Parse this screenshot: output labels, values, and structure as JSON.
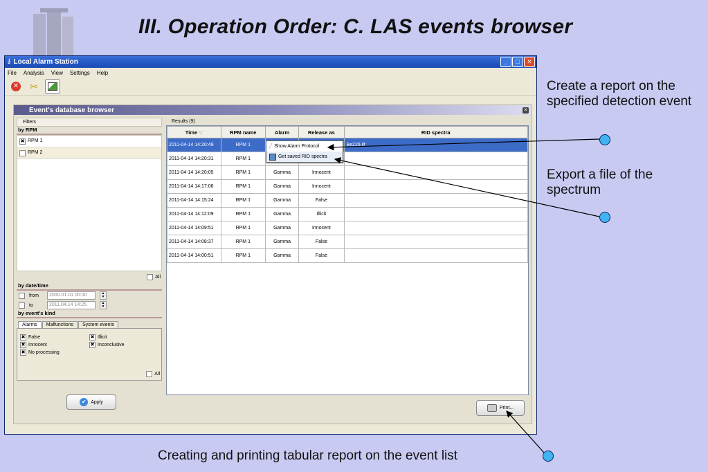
{
  "slide": {
    "title": "III. Operation Order: C. LAS events browser",
    "note_report": "Create a report on the specified detection event",
    "note_export": "Export a file of the spectrum",
    "note_print": "Creating and printing tabular report on the event list"
  },
  "window": {
    "title": "Local Alarm Station",
    "menu": [
      "File",
      "Analysis",
      "View",
      "Settings",
      "Help"
    ]
  },
  "browser": {
    "title": "Event's database browser",
    "filters_tab": "Filters",
    "results_tab": "Results (9)",
    "by_rpm": "by RPM",
    "rpms": [
      {
        "label": "RPM 1",
        "checked": true
      },
      {
        "label": "RPM 2",
        "checked": false
      }
    ],
    "all_label": "All",
    "by_datetime": "by date/time",
    "from_label": "from",
    "from_value": "2000.01.01 00:00",
    "to_label": "to",
    "to_value": "2011.04.14 14:25",
    "by_kind": "by event's kind",
    "kind_tabs": [
      "Alarms",
      "Malfunctions",
      "System events"
    ],
    "kinds": [
      {
        "label": "False",
        "checked": true
      },
      {
        "label": "Illicit",
        "checked": true
      },
      {
        "label": "Innocent",
        "checked": true
      },
      {
        "label": "Inconclusive",
        "checked": true
      },
      {
        "label": "No processing",
        "checked": true
      }
    ],
    "apply_label": "Apply",
    "print_label": "Print...",
    "columns": [
      "Time",
      "RPM name",
      "Alarm",
      "Release as",
      "RID spectra"
    ],
    "rows": [
      {
        "time": "2011-04-14 14:20:49",
        "rpm": "RPM 1",
        "alarm": "",
        "release": "",
        "rid": "Be226.iif"
      },
      {
        "time": "2011-04-14 14:20:31",
        "rpm": "RPM 1",
        "alarm": "",
        "release": "",
        "rid": ""
      },
      {
        "time": "2011-04-14 14:20:05",
        "rpm": "RPM 1",
        "alarm": "Gamma",
        "release": "Innocent",
        "rid": ""
      },
      {
        "time": "2011-04-14 14:17:06",
        "rpm": "RPM 1",
        "alarm": "Gamma",
        "release": "Innocent",
        "rid": ""
      },
      {
        "time": "2011-04-14 14:15:24",
        "rpm": "RPM 1",
        "alarm": "Gamma",
        "release": "False",
        "rid": ""
      },
      {
        "time": "2011-04-14 14:12:09",
        "rpm": "RPM 1",
        "alarm": "Gamma",
        "release": "Illicit",
        "rid": ""
      },
      {
        "time": "2011-04-14 14:09:51",
        "rpm": "RPM 1",
        "alarm": "Gamma",
        "release": "Innocent",
        "rid": ""
      },
      {
        "time": "2011-04-14 14:08:37",
        "rpm": "RPM 1",
        "alarm": "Gamma",
        "release": "False",
        "rid": ""
      },
      {
        "time": "2011-04-14 14:00:51",
        "rpm": "RPM 1",
        "alarm": "Gamma",
        "release": "False",
        "rid": ""
      }
    ],
    "context_menu": [
      "Show Alarm Protocol",
      "Get saved RID spectra"
    ]
  }
}
